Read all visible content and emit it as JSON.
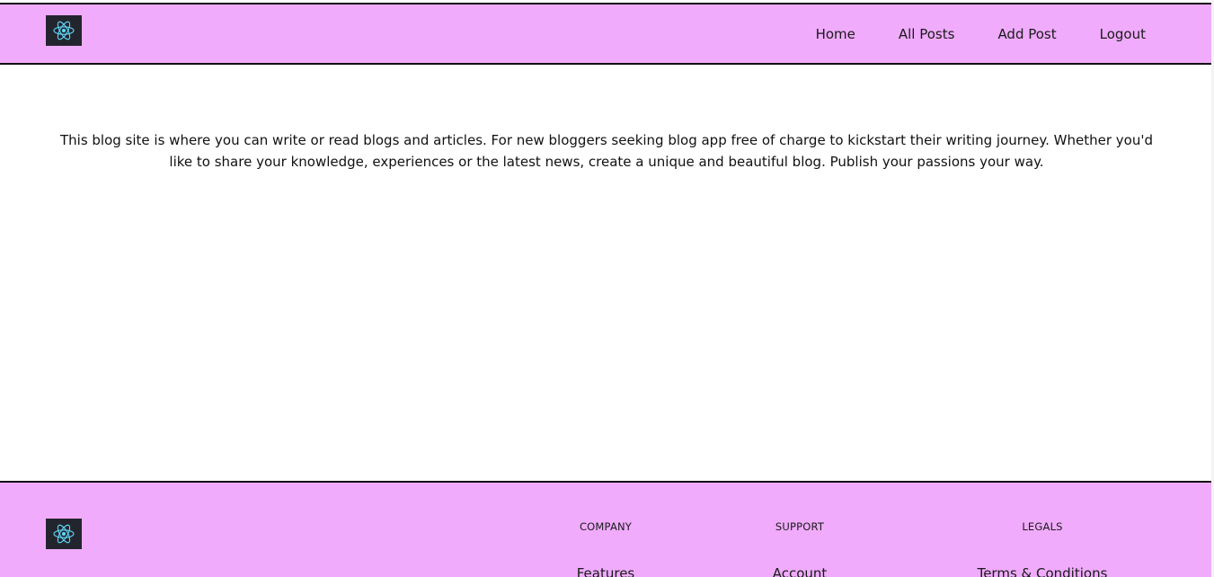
{
  "header": {
    "logo_icon": "react-atom-icon",
    "nav": [
      {
        "label": "Home"
      },
      {
        "label": "All Posts"
      },
      {
        "label": "Add Post"
      },
      {
        "label": "Logout"
      }
    ]
  },
  "main": {
    "intro_text": "This blog site is where you can write or read blogs and articles. For new bloggers seeking blog app free of charge to kickstart their writing journey. Whether you'd like to share your knowledge, experiences or the latest news, create a unique and beautiful blog. Publish your passions your way."
  },
  "footer": {
    "logo_icon": "react-atom-icon",
    "columns": [
      {
        "heading": "COMPANY",
        "first_link": "Features"
      },
      {
        "heading": "SUPPORT",
        "first_link": "Account"
      },
      {
        "heading": "LEGALS",
        "first_link": "Terms & Conditions"
      }
    ]
  },
  "colors": {
    "header_bg": "#f0abfc",
    "footer_bg": "#f0abfc",
    "logo_bg": "#23252e",
    "logo_accent": "#61dafb"
  }
}
